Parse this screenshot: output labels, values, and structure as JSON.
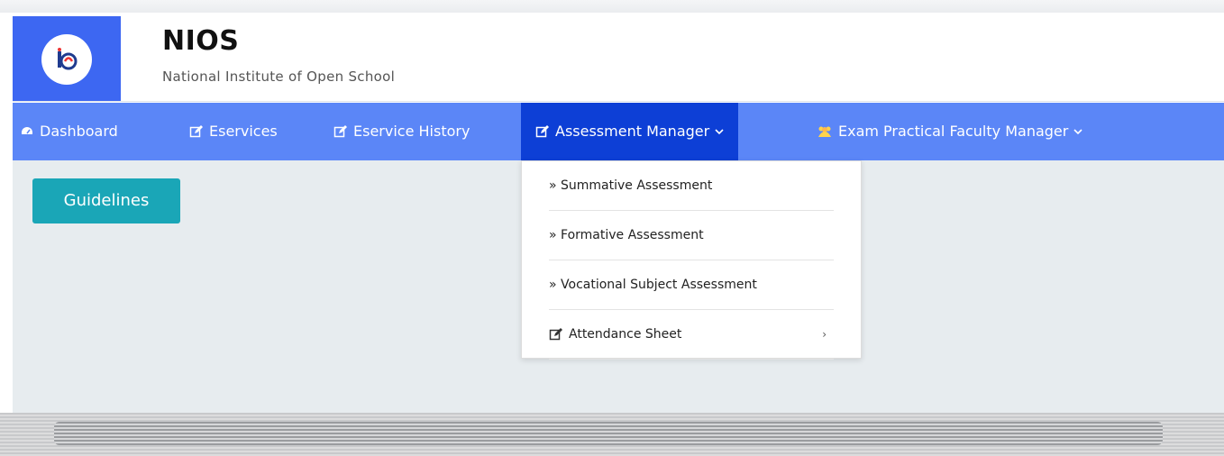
{
  "brand": {
    "title": "NIOS",
    "subtitle": "National Institute of Open School",
    "logo_icon": "nios-logo-icon"
  },
  "nav": {
    "items": [
      {
        "label": "Dashboard",
        "icon": "tachometer-icon"
      },
      {
        "label": "Eservices",
        "icon": "edit-icon"
      },
      {
        "label": "Eservice History",
        "icon": "edit-icon"
      },
      {
        "label": "Assessment Manager",
        "icon": "edit-icon",
        "dropdown": true,
        "active": true
      },
      {
        "label": "Exam Practical Faculty Manager",
        "icon": "users-icon",
        "dropdown": true
      }
    ]
  },
  "dropdown": {
    "items": [
      {
        "label": "» Summative Assessment"
      },
      {
        "label": "» Formative Assessment"
      },
      {
        "label": "» Vocational Subject Assessment"
      },
      {
        "label": "Attendance Sheet",
        "icon": "edit-icon",
        "submenu_arrow": "›"
      }
    ]
  },
  "content": {
    "guidelines_label": "Guidelines"
  },
  "colors": {
    "header_logo_bg": "#3d67f2",
    "navbar_bg": "#5b86f7",
    "navbar_active_bg": "#0d3fd6",
    "content_bg": "#e7ecef",
    "button_bg": "#1aa6b7"
  }
}
